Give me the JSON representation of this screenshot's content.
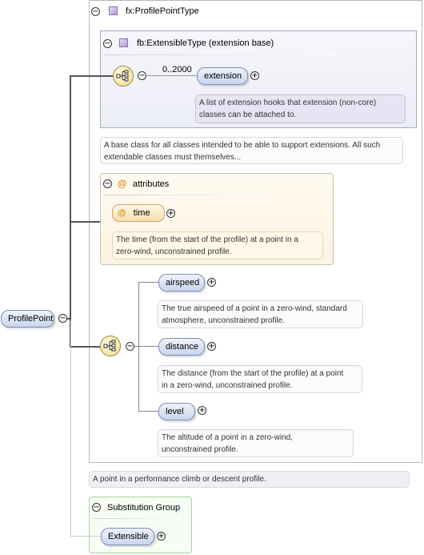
{
  "root_element": {
    "label": "ProfilePoint"
  },
  "complex_type": {
    "label": "fx:ProfilePointType"
  },
  "base_type": {
    "label": "fb:ExtensibleType (extension base)",
    "occurs": "0..2000",
    "element": "extension",
    "note": [
      "A list of extension hooks that extension (non-core)",
      "classes can be attached to."
    ]
  },
  "base_note": [
    "A base class for all classes intended to be able to support extensions. All such",
    "extendable classes must themselves..."
  ],
  "attributes": {
    "label": "attributes",
    "items": [
      {
        "name": "time",
        "note": [
          "The time (from the start of the profile) at a point in a",
          "zero-wind, unconstrained profile."
        ]
      }
    ]
  },
  "sequence_elements": [
    {
      "name": "airspeed",
      "note": [
        "The true airspeed of a point in a zero-wind, standard",
        "atmosphere, unconstrained profile."
      ]
    },
    {
      "name": "distance",
      "note": [
        "The distance (from the start of the profile) at a point",
        "in a zero-wind, unconstrained profile."
      ]
    },
    {
      "name": "level",
      "note": [
        "The altitude of a point in a zero-wind,",
        "unconstrained profile."
      ]
    }
  ],
  "element_note": "A point in a performance climb or descent profile.",
  "substitution_group": {
    "label": "Substitution Group",
    "element": "Extensible"
  },
  "icons": {
    "collapse": "−",
    "expand": "+",
    "attribute_marker": "@"
  }
}
